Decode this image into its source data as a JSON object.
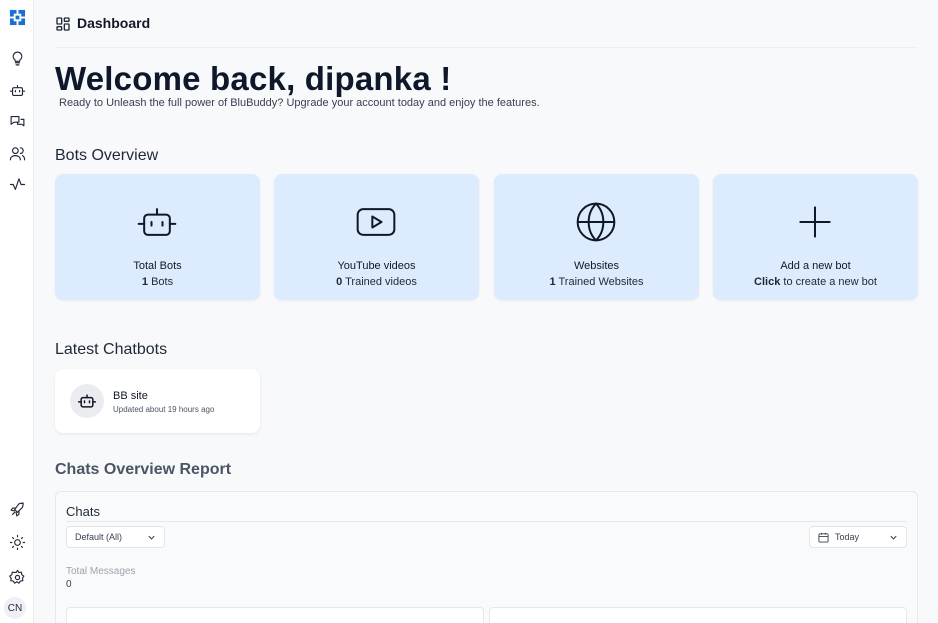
{
  "colors": {
    "accent": "#1b6fd3",
    "card_bg": "#dcebfd",
    "page_bg": "#f8f9fb"
  },
  "sidebar": {
    "logo_icon": "grid-logo-icon",
    "items": [
      {
        "name": "lightbulb-icon"
      },
      {
        "name": "bot-icon"
      },
      {
        "name": "chat-bubbles-icon"
      },
      {
        "name": "users-icon"
      },
      {
        "name": "activity-icon"
      }
    ],
    "bottom_items": [
      {
        "name": "rocket-icon"
      },
      {
        "name": "sun-icon"
      },
      {
        "name": "gear-icon"
      }
    ],
    "avatar_initials": "CN"
  },
  "header": {
    "title": "Dashboard",
    "icon": "dashboard-icon"
  },
  "welcome": {
    "heading": "Welcome back, dipanka !",
    "subtitle": "Ready to Unleash the full power of BluBuddy? Upgrade your account today and enjoy the features."
  },
  "bots_overview": {
    "title": "Bots Overview",
    "cards": [
      {
        "icon": "bot-icon",
        "title": "Total Bots",
        "count": "1",
        "unit": "Bots"
      },
      {
        "icon": "youtube-play-icon",
        "title": "YouTube videos",
        "count": "0",
        "unit": "Trained videos"
      },
      {
        "icon": "globe-icon",
        "title": "Websites",
        "count": "1",
        "unit": "Trained Websites"
      },
      {
        "icon": "plus-icon",
        "title": "Add a new bot",
        "count": "Click",
        "unit": "to create a new bot"
      }
    ]
  },
  "latest_chatbots": {
    "title": "Latest Chatbots",
    "items": [
      {
        "name": "BB site",
        "updated": "Updated about 19 hours ago"
      }
    ]
  },
  "report": {
    "title": "Chats Overview Report",
    "panel_title": "Chats",
    "filter_value": "Default (All)",
    "date_value": "Today",
    "stat_label": "Total Messages",
    "stat_value": "0"
  }
}
